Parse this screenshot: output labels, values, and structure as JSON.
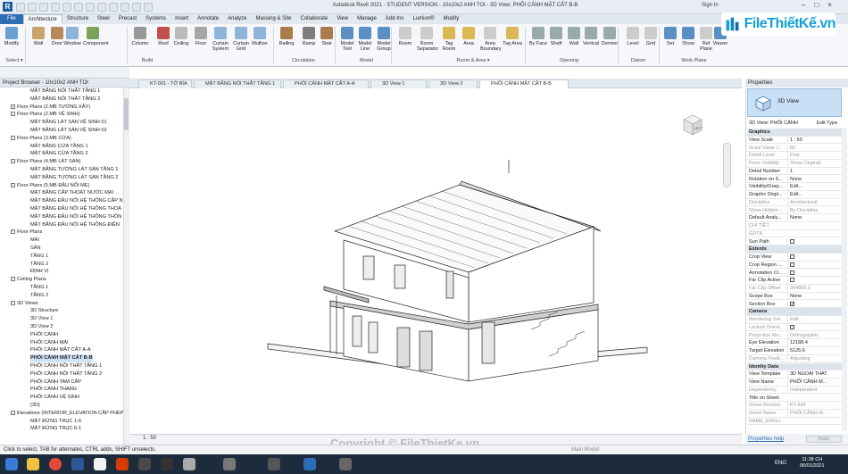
{
  "titlebar": {
    "app_title": "Autodesk Revit 2021 - STUDENT VERSION - 10x10x2 ANH TOI - 3D View: PHỐI CẢNH MẶT CẮT B-B",
    "sign_in": "Sign In",
    "app_letter": "R"
  },
  "ribbon_tabs": [
    "File",
    "Architecture",
    "Structure",
    "Steel",
    "Precast",
    "Systems",
    "Insert",
    "Annotate",
    "Analyze",
    "Massing & Site",
    "Collaborate",
    "View",
    "Manage",
    "Add-Ins",
    "Lumion®",
    "Modify"
  ],
  "ribbon_buttons": [
    {
      "label": "Modify"
    },
    {
      "label": "Wall"
    },
    {
      "label": "Door"
    },
    {
      "label": "Window"
    },
    {
      "label": "Component"
    },
    {
      "label": "Column"
    },
    {
      "label": "Roof"
    },
    {
      "label": "Ceiling"
    },
    {
      "label": "Floor"
    },
    {
      "label": "Curtain System"
    },
    {
      "label": "Curtain Grid"
    },
    {
      "label": "Mullion"
    },
    {
      "label": "Railing"
    },
    {
      "label": "Ramp"
    },
    {
      "label": "Stair"
    },
    {
      "label": "Model Text"
    },
    {
      "label": "Model Line"
    },
    {
      "label": "Model Group"
    },
    {
      "label": "Room"
    },
    {
      "label": "Room Separator"
    },
    {
      "label": "Tag Room"
    },
    {
      "label": "Area"
    },
    {
      "label": "Area Boundary"
    },
    {
      "label": "Tag Area"
    },
    {
      "label": "By Face"
    },
    {
      "label": "Shaft"
    },
    {
      "label": "Wall"
    },
    {
      "label": "Vertical"
    },
    {
      "label": "Dormer"
    },
    {
      "label": "Level"
    },
    {
      "label": "Grid"
    },
    {
      "label": "Set"
    },
    {
      "label": "Show"
    },
    {
      "label": "Ref Plane"
    },
    {
      "label": "Viewer"
    }
  ],
  "ribbon_groups": [
    "Select ▾",
    "Build",
    "Circulation",
    "Model",
    "Room & Area ▾",
    "Opening",
    "Datum",
    "Work Plane"
  ],
  "brand": {
    "text": "FileThiếtKế.vn"
  },
  "project_browser": {
    "title": "Project Browser - 10x10x2 ANH TOI",
    "items": [
      {
        "text": "MẶT BẰNG NỘI THẤT TẦNG 1",
        "level": 2
      },
      {
        "text": "MẶT BẰNG NỘI THẤT TẦNG 2",
        "level": 2
      },
      {
        "text": "Floor Plans (2.MB TƯỜNG XÂY)",
        "level": 1,
        "exp": "+"
      },
      {
        "text": "Floor Plans (2.MB VỆ SINH)",
        "level": 1,
        "exp": "−"
      },
      {
        "text": "MẶT BẰNG LÁT SÀN VỆ SINH 01",
        "level": 2
      },
      {
        "text": "MẶT BẰNG LÁT SÀN VỆ SINH 02",
        "level": 2
      },
      {
        "text": "Floor Plans (3.MB CỬA)",
        "level": 1,
        "exp": "−"
      },
      {
        "text": "MẶT BẰNG CỬA TẦNG 1",
        "level": 2
      },
      {
        "text": "MẶT BẰNG CỬA TẦNG 2",
        "level": 2
      },
      {
        "text": "Floor Plans (4.MB LÁT SÀN)",
        "level": 1,
        "exp": "−"
      },
      {
        "text": "MẶT BẰNG TƯỜNG LÁT SÀN TẦNG 1",
        "level": 2
      },
      {
        "text": "MẶT BẰNG TƯỜNG LÁT SÀN TẦNG 2",
        "level": 2
      },
      {
        "text": "Floor Plans (5.MB ĐẦU NỐI ME)",
        "level": 1,
        "exp": "−"
      },
      {
        "text": "MẶT BẰNG CẤP THOÁT NƯỚC MÁI",
        "level": 2
      },
      {
        "text": "MẶT BẰNG ĐẦU NỐI HỆ THỐNG CẤP N",
        "level": 2
      },
      {
        "text": "MẶT BẰNG ĐẦU NỐI HỆ THỐNG THOÁ",
        "level": 2
      },
      {
        "text": "MẶT BẰNG ĐẦU NỐI HỆ THỐNG THÔN",
        "level": 2
      },
      {
        "text": "MẶT BẰNG ĐẦU NỐI HỆ THỐNG ĐIỆN",
        "level": 2
      },
      {
        "text": "Floor Plans",
        "level": 1,
        "exp": "−"
      },
      {
        "text": "MÁI",
        "level": 2
      },
      {
        "text": "SÂN",
        "level": 2
      },
      {
        "text": "TẦNG 1",
        "level": 2
      },
      {
        "text": "TẦNG 2",
        "level": 2
      },
      {
        "text": "ĐỊNH VỊ",
        "level": 2
      },
      {
        "text": "Ceiling Plans",
        "level": 1,
        "exp": "−"
      },
      {
        "text": "TẦNG 1",
        "level": 2
      },
      {
        "text": "TẦNG 2",
        "level": 2
      },
      {
        "text": "3D Views",
        "level": 1,
        "exp": "−"
      },
      {
        "text": "3D Structure",
        "level": 2
      },
      {
        "text": "3D View 1",
        "level": 2
      },
      {
        "text": "3D View 2",
        "level": 2
      },
      {
        "text": "PHỐI CẢNH",
        "level": 2
      },
      {
        "text": "PHỐI CẢNH MÁI",
        "level": 2
      },
      {
        "text": "PHỐI CẢNH MẶT CẮT A-A",
        "level": 2
      },
      {
        "text": "PHỐI CẢNH MẶT CẮT B-B",
        "level": 2,
        "selected": true
      },
      {
        "text": "PHỐI CẢNH NỘI THẤT TẦNG 1",
        "level": 2
      },
      {
        "text": "PHỐI CẢNH NỘI THẤT TẦNG 2",
        "level": 2
      },
      {
        "text": "PHỐI CẢNH TAM CẤP",
        "level": 2
      },
      {
        "text": "PHỐI CẢNH THANG",
        "level": 2
      },
      {
        "text": "PHỐI CẢNH VỆ SINH",
        "level": 2
      },
      {
        "text": "{3D}",
        "level": 2
      },
      {
        "text": "Elevations (INTERIOR_ELEVATION CẤP PHÉP",
        "level": 1,
        "exp": "−"
      },
      {
        "text": "MẶT ĐỨNG TRỤC 1-6",
        "level": 2
      },
      {
        "text": "MẶT ĐỨNG TRỤC 6-1",
        "level": 2
      }
    ]
  },
  "view_tabs": [
    {
      "label": "KT-001 - TỜ BÌA"
    },
    {
      "label": "MẶT BẰNG NỘI THẤT TẦNG 1"
    },
    {
      "label": "PHỐI CẢNH MẶT CẮT A-A"
    },
    {
      "label": "3D View 1"
    },
    {
      "label": "3D View 2"
    },
    {
      "label": "PHỐI CẢNH MẶT CẮT B-B",
      "active": true
    }
  ],
  "viewcube": {
    "label": "LEFT"
  },
  "view_scale": "1 : 50",
  "properties": {
    "title": "Properties",
    "type_name": "3D View",
    "view_selector": "3D View: PHỐI CẢNH",
    "edit_type": "Edit Type",
    "rows": [
      {
        "k": "Graphics",
        "sec": true
      },
      {
        "k": "View Scale",
        "v": "1 : 50"
      },
      {
        "k": "Scale Value  1:",
        "v": "50",
        "g": true
      },
      {
        "k": "Detail Level",
        "v": "Fine",
        "g": true
      },
      {
        "k": "Parts Visibility",
        "v": "Show Original",
        "g": true
      },
      {
        "k": "Detail Number",
        "v": "1"
      },
      {
        "k": "Rotation on S...",
        "v": "None"
      },
      {
        "k": "Visibility/Grap...",
        "v": "Edit..."
      },
      {
        "k": "Graphic Displ...",
        "v": "Edit..."
      },
      {
        "k": "Discipline",
        "v": "Architectural",
        "g": true
      },
      {
        "k": "Show Hidden ...",
        "v": "By Discipline",
        "g": true
      },
      {
        "k": "Default Analy...",
        "v": "None"
      },
      {
        "k": "CHI TIẾT",
        "v": "",
        "g": true
      },
      {
        "k": "GDTK",
        "v": "",
        "g": true
      },
      {
        "k": "Sun Path",
        "v": "",
        "chk": false
      },
      {
        "k": "Extents",
        "sec": true
      },
      {
        "k": "Crop View",
        "v": "",
        "chk": false
      },
      {
        "k": "Crop Region ...",
        "v": "",
        "chk": false
      },
      {
        "k": "Annotation Cr...",
        "v": "",
        "chk": false
      },
      {
        "k": "Far Clip Active",
        "v": "",
        "chk": false
      },
      {
        "k": "Far Clip Offset",
        "v": "304800,0",
        "g": true
      },
      {
        "k": "Scope Box",
        "v": "None"
      },
      {
        "k": "Section Box",
        "v": "",
        "chk": true
      },
      {
        "k": "Camera",
        "sec": true
      },
      {
        "k": "Rendering Set...",
        "v": "Edit...",
        "g": true
      },
      {
        "k": "Locked Orient...",
        "v": "",
        "g": true,
        "chk": true
      },
      {
        "k": "Projection Mo...",
        "v": "Orthographic",
        "g": true
      },
      {
        "k": "Eye Elevation",
        "v": "12188,4"
      },
      {
        "k": "Target Elevation",
        "v": "5125,6"
      },
      {
        "k": "Camera Positi...",
        "v": "Adjusting",
        "g": true
      },
      {
        "k": "Identity Data",
        "sec": true
      },
      {
        "k": "View Template",
        "v": "3D NGOAI THAT"
      },
      {
        "k": "View Name",
        "v": "PHỐI CẢNH M..."
      },
      {
        "k": "Dependency",
        "v": "Independent",
        "g": true
      },
      {
        "k": "Title on Sheet",
        "v": ""
      },
      {
        "k": "Sheet Number",
        "v": "KT-604",
        "g": true
      },
      {
        "k": "Sheet Name",
        "v": "PHỐI CẢNH M...",
        "g": true
      },
      {
        "k": "NAME_ENGLI...",
        "v": "",
        "g": true
      }
    ],
    "help": "Properties help",
    "apply": "Apply"
  },
  "status_bar": {
    "text": "Click to select, TAB for alternates, CTRL adds, SHIFT unselects.",
    "model": "Main Model"
  },
  "watermark": "Copyright © FileThietKe.vn",
  "taskbar": {
    "time": "11:38 CH",
    "date": "06/01/2021",
    "lang": "ENG"
  },
  "colors": {
    "accent": "#2c6db3",
    "selection": "#cfe3f7",
    "type_selector": "#c8dff5"
  }
}
